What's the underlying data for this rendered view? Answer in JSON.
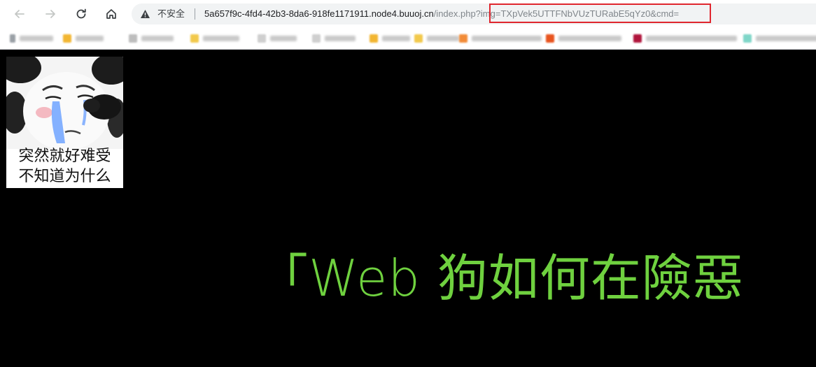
{
  "browser": {
    "security_label": "不安全",
    "url_host": "5a657f9c-4fd4-42b3-8da6-918fe1171911.node4.buuoj.cn",
    "url_path": "/index.ph",
    "url_query": "p?img=TXpVek5UTTFNbVUzTURabE5qYz0&cmd=",
    "icons": {
      "back": "back-arrow-icon",
      "forward": "forward-arrow-icon",
      "reload": "reload-icon",
      "home": "home-icon",
      "security": "warning-triangle-icon"
    },
    "highlight_color": "#e0262e"
  },
  "page": {
    "meme_caption_line1": "突然就好难受",
    "meme_caption_line2": "不知道为什么",
    "headline": "「Web 狗如何在險惡",
    "headline_color": "#6fd13f",
    "background_color": "#000000"
  }
}
